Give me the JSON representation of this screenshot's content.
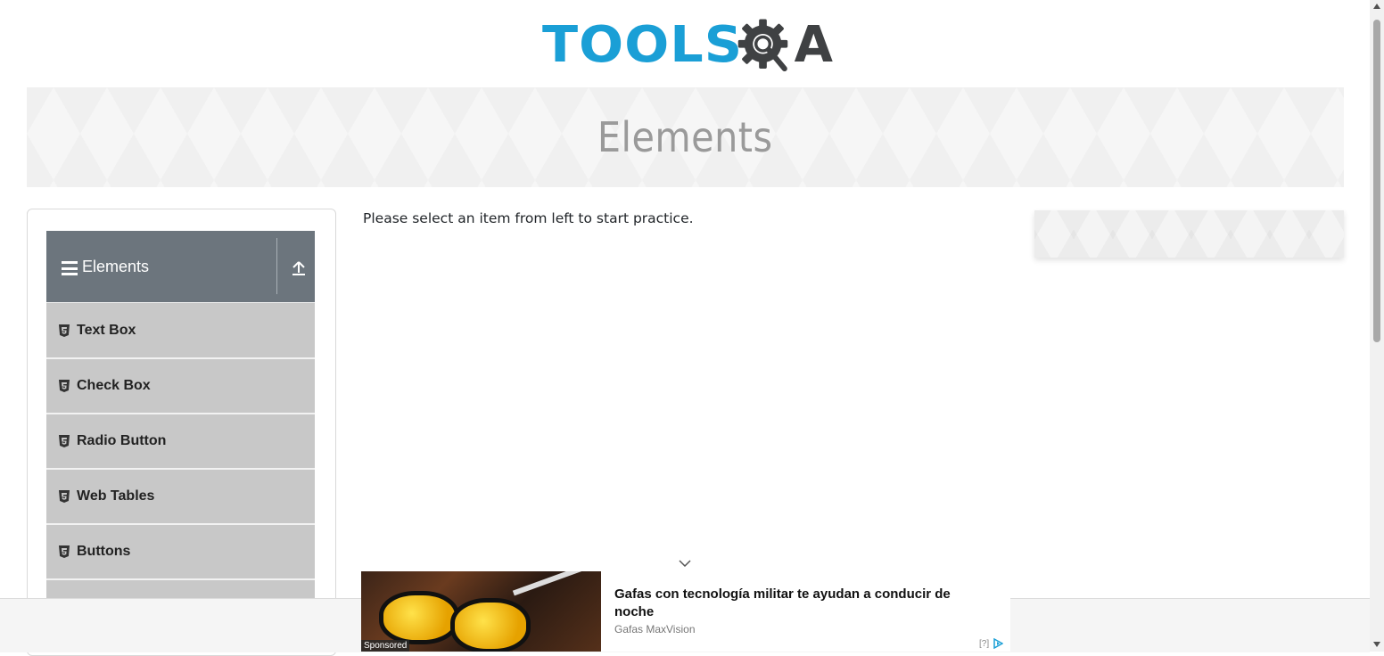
{
  "header": {
    "logo_text_tools": "TOOLS",
    "logo_text_qa": "A",
    "brand_colors": {
      "tools": "#1a9fd6",
      "qa": "#3f4143"
    }
  },
  "banner": {
    "title": "Elements"
  },
  "sidebar": {
    "group": {
      "label": "Elements",
      "icon": "menu-icon",
      "collapse_icon": "upload-arrow-icon",
      "background": "#6c757d"
    },
    "items": [
      {
        "label": "Text Box",
        "icon": "html5-icon"
      },
      {
        "label": "Check Box",
        "icon": "html5-icon"
      },
      {
        "label": "Radio Button",
        "icon": "html5-icon"
      },
      {
        "label": "Web Tables",
        "icon": "html5-icon"
      },
      {
        "label": "Buttons",
        "icon": "html5-icon"
      }
    ]
  },
  "main": {
    "instruction": "Please select an item from left to start practice."
  },
  "ad": {
    "headline": "Gafas con tecnología militar te ayudan a conducir de noche",
    "advertiser": "Gafas MaxVision",
    "sponsored_label": "Sponsored",
    "info_label": "[?]"
  }
}
